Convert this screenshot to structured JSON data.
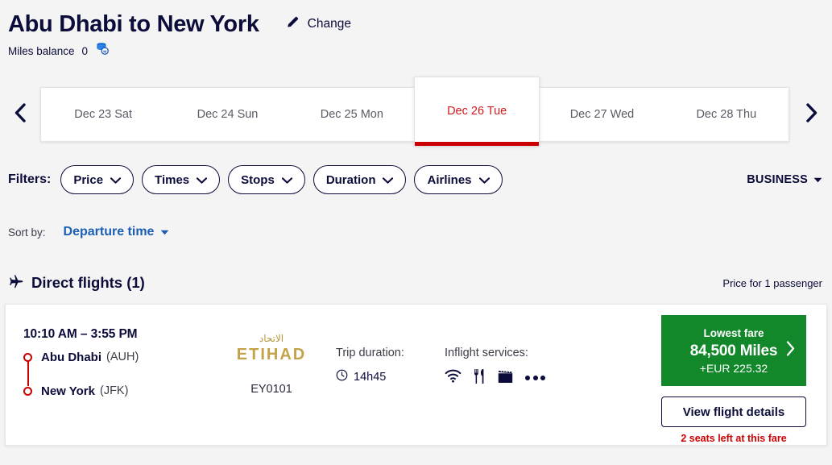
{
  "header": {
    "title": "Abu Dhabi to New York",
    "change_label": "Change",
    "change_icon": "pencil-icon",
    "miles_label": "Miles balance",
    "miles_value": "0",
    "miles_icon": "coins-miles-icon"
  },
  "date_strip": {
    "prev_icon": "chevron-left-icon",
    "next_icon": "chevron-right-icon",
    "active_index": 3,
    "active_color": "#cc0000",
    "dates": [
      {
        "label": "Dec 23 Sat",
        "active": false
      },
      {
        "label": "Dec 24 Sun",
        "active": false
      },
      {
        "label": "Dec 25 Mon",
        "active": false
      },
      {
        "label": "Dec 26 Tue",
        "active": true
      },
      {
        "label": "Dec 27 Wed",
        "active": false
      },
      {
        "label": "Dec 28 Thu",
        "active": false
      }
    ]
  },
  "filters": {
    "label": "Filters:",
    "items": [
      {
        "label": "Price"
      },
      {
        "label": "Times"
      },
      {
        "label": "Stops"
      },
      {
        "label": "Duration"
      },
      {
        "label": "Airlines"
      }
    ],
    "cabin_class": "BUSINESS"
  },
  "sort": {
    "label": "Sort by:",
    "value": "Departure time",
    "link_color": "#1a5fb4"
  },
  "section": {
    "plane_icon": "airplane-icon",
    "title": "Direct flights (1)",
    "price_note": "Price for 1 passenger"
  },
  "flight": {
    "times": "10:10 AM – 3:55 PM",
    "origin_city": "Abu Dhabi",
    "origin_code": "(AUH)",
    "destination_city": "New York",
    "destination_code": "(JFK)",
    "airline_arabic": "الاتحاد",
    "airline_name": "ETIHAD",
    "airline_color": "#c3a24a",
    "flight_number": "EY0101",
    "duration_label": "Trip duration:",
    "duration_value": "14h45",
    "duration_icon": "clock-icon",
    "services_label": "Inflight services:",
    "service_icons": [
      "wifi-icon",
      "meal-icon",
      "entertainment-icon",
      "more-icon"
    ],
    "fare": {
      "title": "Lowest fare",
      "miles": "84,500 Miles",
      "cash": "+EUR 225.32",
      "chevron_icon": "chevron-right-icon",
      "color": "#12882b"
    },
    "details_button": "View flight details",
    "seats_left": "2 seats left at this fare",
    "seats_color": "#cc0000"
  }
}
